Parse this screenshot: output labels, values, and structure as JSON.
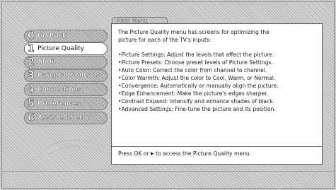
{
  "sidebar": {
    "items": [
      {
        "num": "0",
        "label": "Go Back"
      },
      {
        "num": "1",
        "label": "Picture Quality"
      },
      {
        "num": "2",
        "label": "Audio"
      },
      {
        "num": "3",
        "label": "Parental Controls"
      },
      {
        "num": "4",
        "label": "Connections"
      },
      {
        "num": "5",
        "label": "Preferences"
      },
      {
        "num": "6",
        "label": "Assisted Setup"
      }
    ],
    "selected_index": 1
  },
  "panel": {
    "tab_label": "Main Menu",
    "intro_line1": "The Picture Quality menu has screens for optimizing the",
    "intro_line2": "picture for each of the TV's inputs:",
    "features": [
      "Picture Settings: Adjust the levels that affect the picture.",
      "Picture Presets: Choose preset levels of Picture Settings.",
      "Auto Color: Correct the color from channel to channel.",
      "Color Warmth: Adjust the color to Cool, Warm, or Normal.",
      "Convergence: Automatically or manually align the picture.",
      "Edge Enhancement: Make the picture's edges sharper.",
      "Contrast Expand: Intensify and enhance shades of black.",
      "Advanced Settings: Fine-tune the picture and its position."
    ],
    "bullet": "•",
    "hint_prefix": "Press OK or",
    "hint_arrow_icon": "right-triangle-arrow",
    "hint_suffix": "to access the Picture Quality menu."
  },
  "colors": {
    "screen_bg": "#d6d6d6",
    "panel_bg": "#ffffff",
    "panel_border": "#555555",
    "menu_item_bg": "#a9a9a9",
    "menu_selected_bg": "#ffffff"
  }
}
